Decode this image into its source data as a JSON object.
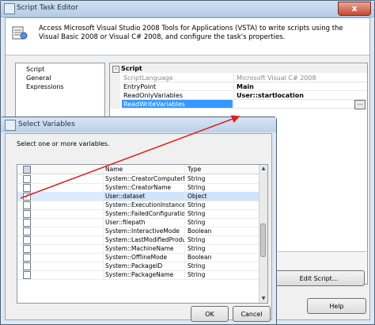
{
  "main_window": {
    "title": "Script Task Editor",
    "close_label": "x",
    "header_text": "Access Microsoft Visual Studio 2008 Tools for Applications (VSTA) to write scripts using the Visual Basic 2008 or Visual C# 2008, and configure the task's properties.",
    "nav_items": [
      "Script",
      "General",
      "Expressions"
    ],
    "grid": {
      "category": "Script",
      "toggle": "-",
      "rows": [
        {
          "name": "ScriptLanguage",
          "value": "Microsoft Visual C# 2008"
        },
        {
          "name": "EntryPoint",
          "value": "Main"
        },
        {
          "name": "ReadOnlyVariables",
          "value": "User::startlocation"
        },
        {
          "name": "ReadWriteVariables",
          "value": ""
        }
      ],
      "ellipsis": "..."
    },
    "edit_script_label": "Edit Script...",
    "help_label": "Help"
  },
  "dialog": {
    "title": "Select Variables",
    "prompt": "Select one or more variables.",
    "columns": {
      "name": "Name",
      "type": "Type"
    },
    "rows": [
      {
        "name": "System::CreatorComputerN...",
        "type": "String",
        "checked": false
      },
      {
        "name": "System::CreatorName",
        "type": "String",
        "checked": false
      },
      {
        "name": "User::dataset",
        "type": "Object",
        "checked": true
      },
      {
        "name": "System::ExecutionInstance...",
        "type": "String",
        "checked": false
      },
      {
        "name": "System::FailedConfigurations",
        "type": "String",
        "checked": false
      },
      {
        "name": "User::filepath",
        "type": "String",
        "checked": false
      },
      {
        "name": "System::InteractiveMode",
        "type": "Boolean",
        "checked": false
      },
      {
        "name": "System::LastModifiedProdu...",
        "type": "String",
        "checked": false
      },
      {
        "name": "System::MachineName",
        "type": "String",
        "checked": false
      },
      {
        "name": "System::OfflineMode",
        "type": "Boolean",
        "checked": false
      },
      {
        "name": "System::PackageID",
        "type": "String",
        "checked": false
      },
      {
        "name": "System::PackageName",
        "type": "String",
        "checked": false
      }
    ],
    "ok_label": "OK",
    "cancel_label": "Cancel"
  },
  "colors": {
    "selection": "#3399ff",
    "arrow": "#e02020"
  }
}
